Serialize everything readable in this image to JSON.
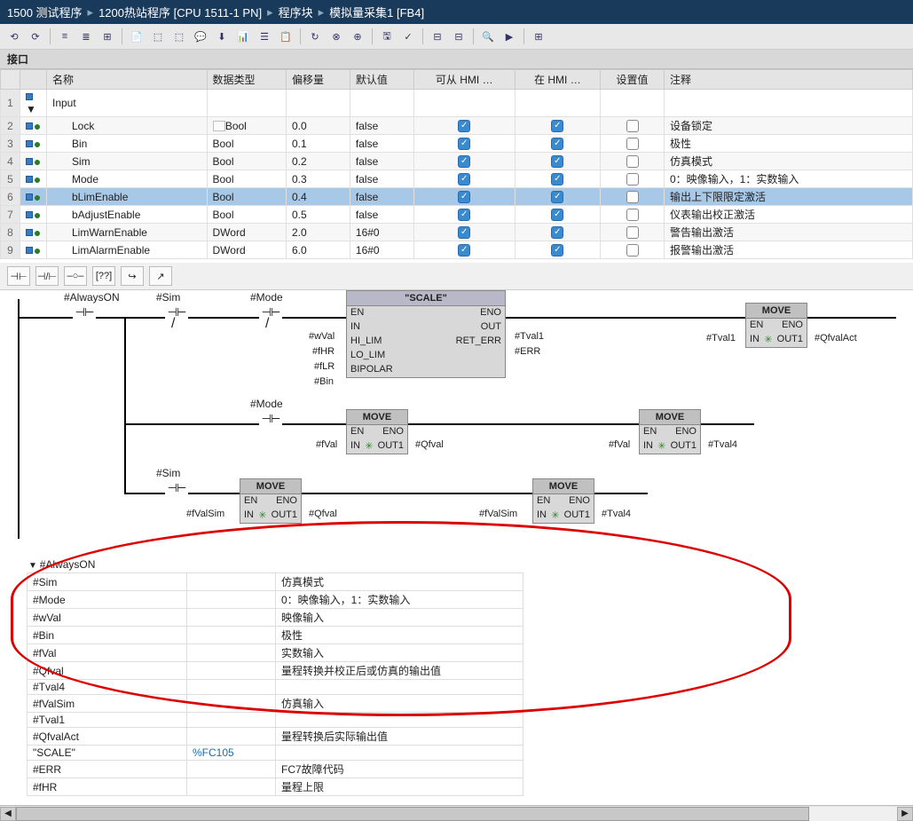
{
  "breadcrumb": [
    "1500 测试程序",
    "1200热站程序 [CPU 1511-1 PN]",
    "程序块",
    "模拟量采集1 [FB4]"
  ],
  "interfaceHeader": "接口",
  "columns": {
    "name": "名称",
    "dtype": "数据类型",
    "offset": "偏移量",
    "default": "默认值",
    "hmiRead": "可从 HMI …",
    "hmiWrite": "在 HMI …",
    "setval": "设置值",
    "comment": "注释"
  },
  "inputGroup": "Input",
  "rows": [
    {
      "n": 1,
      "name": "Input",
      "dtype": "",
      "offset": "",
      "default": "",
      "h1": null,
      "h2": null,
      "sv": null,
      "comment": "",
      "group": true
    },
    {
      "n": 2,
      "name": "Lock",
      "dtype": "Bool",
      "offset": "0.0",
      "default": "false",
      "h1": true,
      "h2": true,
      "sv": false,
      "comment": "设备锁定",
      "dticon": true
    },
    {
      "n": 3,
      "name": "Bin",
      "dtype": "Bool",
      "offset": "0.1",
      "default": "false",
      "h1": true,
      "h2": true,
      "sv": false,
      "comment": "极性"
    },
    {
      "n": 4,
      "name": "Sim",
      "dtype": "Bool",
      "offset": "0.2",
      "default": "false",
      "h1": true,
      "h2": true,
      "sv": false,
      "comment": "仿真模式"
    },
    {
      "n": 5,
      "name": "Mode",
      "dtype": "Bool",
      "offset": "0.3",
      "default": "false",
      "h1": true,
      "h2": true,
      "sv": false,
      "comment": "0：映像输入，1：实数输入"
    },
    {
      "n": 6,
      "name": "bLimEnable",
      "dtype": "Bool",
      "offset": "0.4",
      "default": "false",
      "h1": true,
      "h2": true,
      "sv": false,
      "comment": "输出上下限限定激活",
      "sel": true
    },
    {
      "n": 7,
      "name": "bAdjustEnable",
      "dtype": "Bool",
      "offset": "0.5",
      "default": "false",
      "h1": true,
      "h2": true,
      "sv": false,
      "comment": "仪表输出校正激活"
    },
    {
      "n": 8,
      "name": "LimWarnEnable",
      "dtype": "DWord",
      "offset": "2.0",
      "default": "16#0",
      "h1": true,
      "h2": true,
      "sv": false,
      "comment": "警告输出激活"
    },
    {
      "n": 9,
      "name": "LimAlarmEnable",
      "dtype": "DWord",
      "offset": "6.0",
      "default": "16#0",
      "h1": true,
      "h2": true,
      "sv": false,
      "comment": "报警输出激活"
    }
  ],
  "ladToolbar": [
    "⊣⊢",
    "⊣/⊢",
    "–○–",
    "[??]",
    "↪",
    "↗"
  ],
  "network": {
    "contacts": {
      "alwaysOn": "#AlwaysON",
      "sim": "#Sim",
      "mode": "#Mode"
    },
    "scale": {
      "title": "\"SCALE\"",
      "pins": {
        "en": "EN",
        "in": "IN",
        "hilim": "HI_LIM",
        "lolim": "LO_LIM",
        "bipolar": "BIPOLAR",
        "eno": "ENO",
        "out": "OUT",
        "reterr": "RET_ERR"
      },
      "inLabels": {
        "wval": "#wVal",
        "fhr": "#fHR",
        "flr": "#fLR",
        "bin": "#Bin"
      },
      "outLabels": {
        "tval1": "#Tval1",
        "err": "#ERR"
      }
    },
    "moveTitle": "MOVE",
    "movePins": {
      "en": "EN",
      "in": "IN",
      "eno": "ENO",
      "out1": "OUT1"
    },
    "move1": {
      "in": "#Tval1",
      "out": "#QfvalAct"
    },
    "move2": {
      "in": "#fVal",
      "out": "#Qfval"
    },
    "move3": {
      "in": "#fVal",
      "out": "#Tval4"
    },
    "move4": {
      "in": "#fValSim",
      "out": "#Qfval"
    },
    "move5": {
      "in": "#fValSim",
      "out": "#Tval4"
    }
  },
  "varlistHeader": "#AlwaysON",
  "varlist": [
    {
      "name": "#Sim",
      "val": "",
      "cmt": "仿真模式"
    },
    {
      "name": "#Mode",
      "val": "",
      "cmt": "0：映像输入，1：实数输入"
    },
    {
      "name": "#wVal",
      "val": "",
      "cmt": "映像输入"
    },
    {
      "name": "#Bin",
      "val": "",
      "cmt": "极性"
    },
    {
      "name": "#fVal",
      "val": "",
      "cmt": "实数输入"
    },
    {
      "name": "#Qfval",
      "val": "",
      "cmt": "量程转换并校正后或仿真的输出值"
    },
    {
      "name": "#Tval4",
      "val": "",
      "cmt": ""
    },
    {
      "name": "#fValSim",
      "val": "",
      "cmt": "仿真输入"
    },
    {
      "name": "#Tval1",
      "val": "",
      "cmt": ""
    },
    {
      "name": "#QfvalAct",
      "val": "",
      "cmt": "量程转换后实际输出值"
    },
    {
      "name": "\"SCALE\"",
      "val": "%FC105",
      "cmt": ""
    },
    {
      "name": "#ERR",
      "val": "",
      "cmt": "FC7故障代码"
    },
    {
      "name": "#fHR",
      "val": "",
      "cmt": "量程上限"
    }
  ]
}
